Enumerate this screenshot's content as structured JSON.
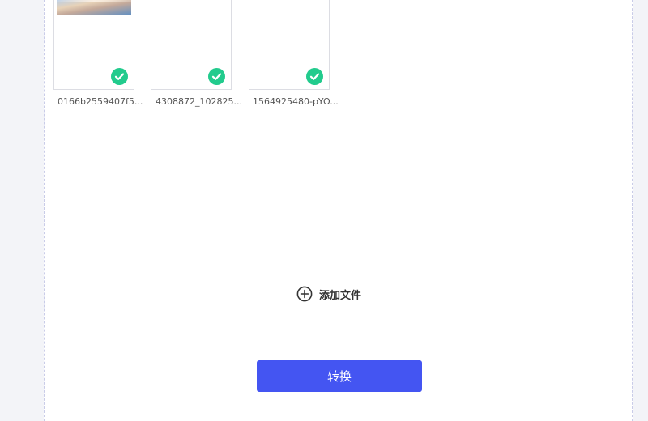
{
  "files": [
    {
      "name": "0166b2559407f5...",
      "has_preview": true,
      "status_icon": "check-circle-icon"
    },
    {
      "name": "4308872_102825...",
      "has_preview": false,
      "status_icon": "check-circle-icon"
    },
    {
      "name": "1564925480-pYO...",
      "has_preview": false,
      "status_icon": "check-circle-icon"
    }
  ],
  "add_file": {
    "label": "添加文件",
    "icon": "plus-circle-icon"
  },
  "convert_button": {
    "label": "转换"
  },
  "colors": {
    "accent": "#4455f2",
    "success": "#22cb8d",
    "panel_border": "#c9cce8",
    "background": "#f3f4f8"
  }
}
